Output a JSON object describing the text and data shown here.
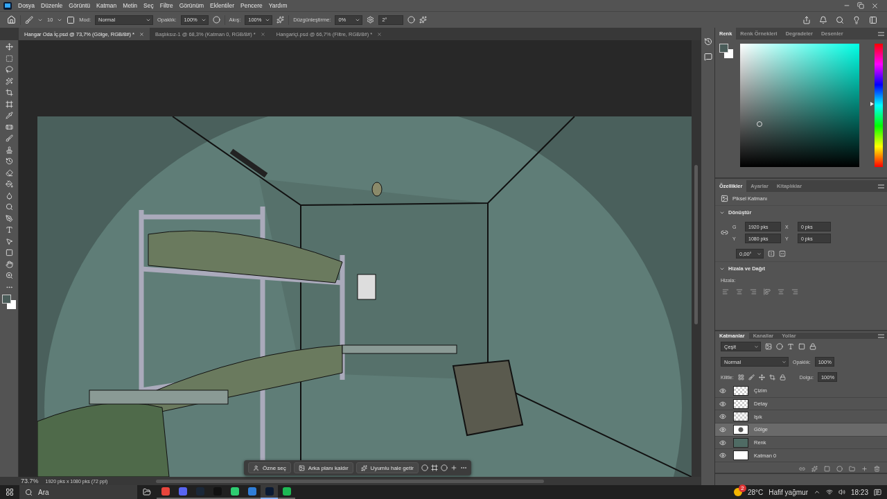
{
  "menu": [
    "Dosya",
    "Düzenle",
    "Görüntü",
    "Katman",
    "Metin",
    "Seç",
    "Filtre",
    "Görünüm",
    "Eklentiler",
    "Pencere",
    "Yardım"
  ],
  "options": {
    "brush_size": "10",
    "mode_label": "Mod:",
    "mode": "Normal",
    "opacity_label": "Opaklık:",
    "opacity": "100%",
    "flow_label": "Akış:",
    "flow": "100%",
    "smoothing_label": "Düzgünleştirme:",
    "smoothing": "0%",
    "angle": "2°"
  },
  "doc_tabs": [
    {
      "label": "Hangar Oda İç.psd @ 73,7% (Gölge, RGB/8#) *",
      "selected": true
    },
    {
      "label": "Başlıksız-1 @ 68,3% (Katman 0, RGB/8#) *",
      "selected": false
    },
    {
      "label": "Hangariçi.psd @ 66,7% (Filtre, RGB/8#) *",
      "selected": false
    }
  ],
  "color_panel": {
    "tabs": [
      {
        "label": "Renk",
        "selected": true
      },
      {
        "label": "Renk Örnekleri",
        "selected": false
      },
      {
        "label": "Degradeler",
        "selected": false
      },
      {
        "label": "Desenler",
        "selected": false
      }
    ],
    "hue": {
      "level": 0.51
    }
  },
  "properties": {
    "tabs": [
      {
        "label": "Özellikler",
        "selected": true
      },
      {
        "label": "Ayarlar",
        "selected": false
      },
      {
        "label": "Kitaplıklar",
        "selected": false
      }
    ],
    "layer_type": "Piksel Katmanı",
    "transform_title": "Dönüştür",
    "w_label": "G",
    "w": "1920 pks",
    "x_label": "X",
    "x": "0 pks",
    "h_label": "Y",
    "h": "1080 pks",
    "y_label": "Y",
    "y": "0 pks",
    "angle": "0,00°",
    "align_title": "Hizala ve Dağıt",
    "align_label": "Hizala:"
  },
  "layers": {
    "tabs": [
      {
        "label": "Katmanlar",
        "selected": true
      },
      {
        "label": "Kanallar",
        "selected": false
      },
      {
        "label": "Yollar",
        "selected": false
      }
    ],
    "filter": "Çeşit",
    "blend": "Normal",
    "opacity_label": "Opaklık:",
    "opacity": "100%",
    "lock_label": "Kilitle:",
    "fill_label": "Dolgu:",
    "fill": "100%",
    "items": [
      {
        "name": "Çizim",
        "kind": "transparent",
        "visible": true,
        "selected": false
      },
      {
        "name": "Detay",
        "kind": "transparent",
        "visible": true,
        "selected": false
      },
      {
        "name": "Işık",
        "kind": "transparent",
        "visible": true,
        "selected": false
      },
      {
        "name": "Gölge",
        "kind": "sketch",
        "visible": true,
        "selected": true
      },
      {
        "name": "Renk",
        "kind": "color",
        "visible": true,
        "selected": false
      },
      {
        "name": "Katman 0",
        "kind": "white",
        "visible": true,
        "selected": false
      }
    ]
  },
  "context_bar": [
    "Özne seç",
    "Arka planı kaldır",
    "Uyumlu hale getir"
  ],
  "status": {
    "zoom": "73.7%",
    "info": "1920 pks x 1080 pks (72 ppi)"
  },
  "taskbar": {
    "search": "Ara",
    "apps": [
      {
        "kind": "chrome",
        "selected": false
      },
      {
        "kind": "discord",
        "selected": false
      },
      {
        "kind": "steam",
        "selected": false
      },
      {
        "kind": "epic",
        "selected": false
      },
      {
        "kind": "green",
        "selected": false
      },
      {
        "kind": "photos",
        "selected": false
      },
      {
        "kind": "photoshop",
        "selected": true
      },
      {
        "kind": "spotify",
        "selected": false
      }
    ],
    "weather_badge": "2",
    "temperature": "28°C",
    "weather": "Hafif yağmur",
    "time": "18:23"
  }
}
